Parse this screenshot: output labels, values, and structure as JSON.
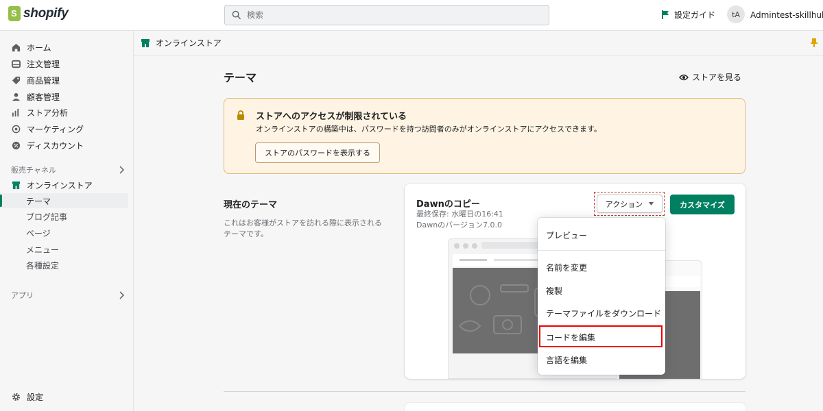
{
  "app": {
    "logo_text": "shopify"
  },
  "topbar": {
    "search_placeholder": "検索",
    "setup_guide": "設定ガイド",
    "avatar_initials": "tA",
    "account_name": "Admintest-skillhubス"
  },
  "sidebar": {
    "items": [
      {
        "label": "ホーム",
        "icon": "home-icon"
      },
      {
        "label": "注文管理",
        "icon": "inbox-icon"
      },
      {
        "label": "商品管理",
        "icon": "tag-icon"
      },
      {
        "label": "顧客管理",
        "icon": "person-icon"
      },
      {
        "label": "ストア分析",
        "icon": "bar-chart-icon"
      },
      {
        "label": "マーケティング",
        "icon": "target-icon"
      },
      {
        "label": "ディスカウント",
        "icon": "discount-icon"
      }
    ],
    "sales_channels_label": "販売チャネル",
    "online_store_label": "オンラインストア",
    "sub_items": [
      "テーマ",
      "ブログ記事",
      "ページ",
      "メニュー",
      "各種設定"
    ],
    "apps_label": "アプリ",
    "settings_label": "設定"
  },
  "storebar": {
    "title": "オンラインストア"
  },
  "main": {
    "page_title": "テーマ",
    "view_store": "ストアを見る",
    "banner": {
      "title": "ストアへのアクセスが制限されている",
      "description": "オンラインストアの構築中は、パスワードを持つ訪問者のみがオンラインストアにアクセスできます。",
      "button": "ストアのパスワードを表示する"
    },
    "current_theme": {
      "heading": "現在のテーマ",
      "description": "これはお客様がストアを訪れる際に表示されるテーマです。",
      "name": "Dawnのコピー",
      "last_saved": "最終保存: 水曜日の16:41",
      "version": "Dawnのバージョン7.0.0",
      "actions_button": "アクション",
      "customize_button": "カスタマイズ"
    }
  },
  "dropdown": {
    "items": [
      "プレビュー",
      "名前を変更",
      "複製",
      "テーマファイルをダウンロード",
      "コードを編集",
      "言語を編集"
    ],
    "highlighted": "コードを編集"
  },
  "colors": {
    "brand_green": "#008060",
    "banner_bg": "#fff4e4",
    "banner_border": "#e1b878",
    "highlight_red": "#e00000",
    "sidebar_bg": "#f6f6f7"
  }
}
